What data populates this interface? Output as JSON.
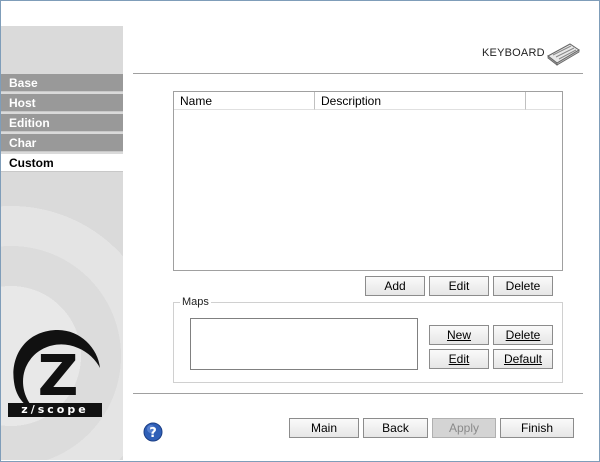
{
  "sidebar": {
    "items": [
      {
        "label": "Base",
        "active": false
      },
      {
        "label": "Host",
        "active": false
      },
      {
        "label": "Edition",
        "active": false
      },
      {
        "label": "Char",
        "active": false
      },
      {
        "label": "Custom",
        "active": true
      }
    ],
    "logo_text": "z/scope"
  },
  "header": {
    "title": "KEYBOARD",
    "icon": "keyboard-icon"
  },
  "list": {
    "columns": [
      "Name",
      "Description"
    ],
    "rows": []
  },
  "list_buttons": {
    "add": "Add",
    "edit": "Edit",
    "delete": "Delete"
  },
  "maps": {
    "label": "Maps",
    "new": "New",
    "delete": "Delete",
    "edit": "Edit",
    "default": "Default"
  },
  "footer": {
    "help_icon": "help-icon",
    "main": "Main",
    "back": "Back",
    "apply": "Apply",
    "finish": "Finish"
  },
  "colors": {
    "sidebar_item_bg": "#999999",
    "help_icon": "#2f5fb7"
  }
}
